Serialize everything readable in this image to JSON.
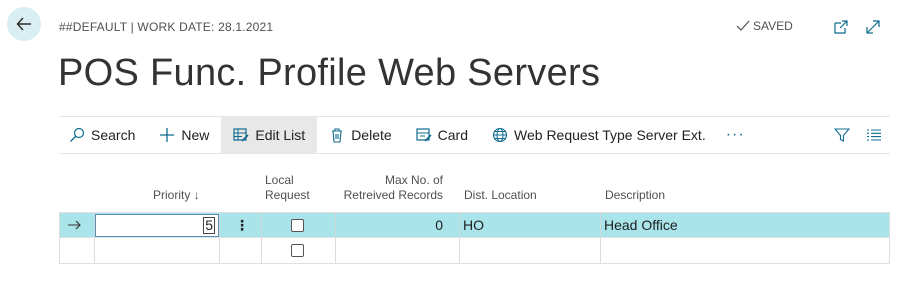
{
  "header": {
    "context": "##DEFAULT | WORK DATE: 28.1.2021",
    "saved": "SAVED",
    "title": "POS Func. Profile Web Servers"
  },
  "actions": {
    "search": "Search",
    "new": "New",
    "edit_list": "Edit List",
    "delete": "Delete",
    "card": "Card",
    "web_request": "Web Request Type Server Ext.",
    "more": "···"
  },
  "columns": {
    "priority": "Priority",
    "priority_sort": "↓",
    "local_request_1": "Local",
    "local_request_2": "Request",
    "max_records_1": "Max No. of",
    "max_records_2": "Retreived Records",
    "dist_location": "Dist. Location",
    "description": "Description"
  },
  "rows": [
    {
      "priority": "5",
      "local_request": false,
      "max_records": "0",
      "dist_location": "HO",
      "description": "Head Office"
    },
    {
      "priority": "",
      "local_request": false,
      "max_records": "",
      "dist_location": "",
      "description": ""
    }
  ],
  "colors": {
    "selected_row": "#a9e4ea",
    "accent": "#0f6c8f",
    "back_button_bg": "#d9eef2"
  }
}
